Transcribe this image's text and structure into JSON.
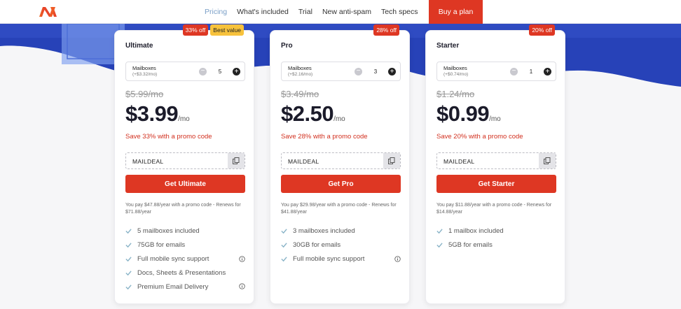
{
  "nav": {
    "links": [
      {
        "label": "Pricing",
        "active": true
      },
      {
        "label": "What's included",
        "active": false
      },
      {
        "label": "Trial",
        "active": false
      },
      {
        "label": "New anti-spam",
        "active": false
      },
      {
        "label": "Tech specs",
        "active": false
      }
    ],
    "cta_label": "Buy a plan"
  },
  "colors": {
    "accent": "#de3723",
    "hero": "#2742b8",
    "badge_yellow": "#f7c23c",
    "nav_active": "#7a9fc7"
  },
  "plans": [
    {
      "name": "Ultimate",
      "badges": {
        "discount": "33% off",
        "extra": "Best value"
      },
      "mailboxes_label": "Mailboxes",
      "mailboxes_sub": "(+$3.32/mo)",
      "mailboxes_count": "5",
      "old_price": "$5.99/mo",
      "price": "$3.99",
      "per": "/mo",
      "save": "Save 33% with a promo code",
      "promo_code": "MAILDEAL",
      "cta": "Get Ultimate",
      "pay_note": "You pay $47.88/year with a promo code - Renews for $71.88/year",
      "features": [
        {
          "text": "5 mailboxes included",
          "info": false
        },
        {
          "text": "75GB for emails",
          "info": false
        },
        {
          "text": "Full mobile sync support",
          "info": true
        },
        {
          "text": "Docs, Sheets & Presentations",
          "info": false
        },
        {
          "text": "Premium Email Delivery",
          "info": true
        }
      ]
    },
    {
      "name": "Pro",
      "badges": {
        "discount": "28% off",
        "extra": ""
      },
      "mailboxes_label": "Mailboxes",
      "mailboxes_sub": "(+$2.16/mo)",
      "mailboxes_count": "3",
      "old_price": "$3.49/mo",
      "price": "$2.50",
      "per": "/mo",
      "save": "Save 28% with a promo code",
      "promo_code": "MAILDEAL",
      "cta": "Get Pro",
      "pay_note": "You pay $29.98/year with a promo code - Renews for $41.88/year",
      "features": [
        {
          "text": "3 mailboxes included",
          "info": false
        },
        {
          "text": "30GB for emails",
          "info": false
        },
        {
          "text": "Full mobile sync support",
          "info": true
        }
      ]
    },
    {
      "name": "Starter",
      "badges": {
        "discount": "20% off",
        "extra": ""
      },
      "mailboxes_label": "Mailboxes",
      "mailboxes_sub": "(+$0.74/mo)",
      "mailboxes_count": "1",
      "old_price": "$1.24/mo",
      "price": "$0.99",
      "per": "/mo",
      "save": "Save 20% with a promo code",
      "promo_code": "MAILDEAL",
      "cta": "Get Starter",
      "pay_note": "You pay $11.88/year with a promo code - Renews for $14.88/year",
      "features": [
        {
          "text": "1 mailbox included",
          "info": false
        },
        {
          "text": "5GB for emails",
          "info": false
        }
      ]
    }
  ]
}
